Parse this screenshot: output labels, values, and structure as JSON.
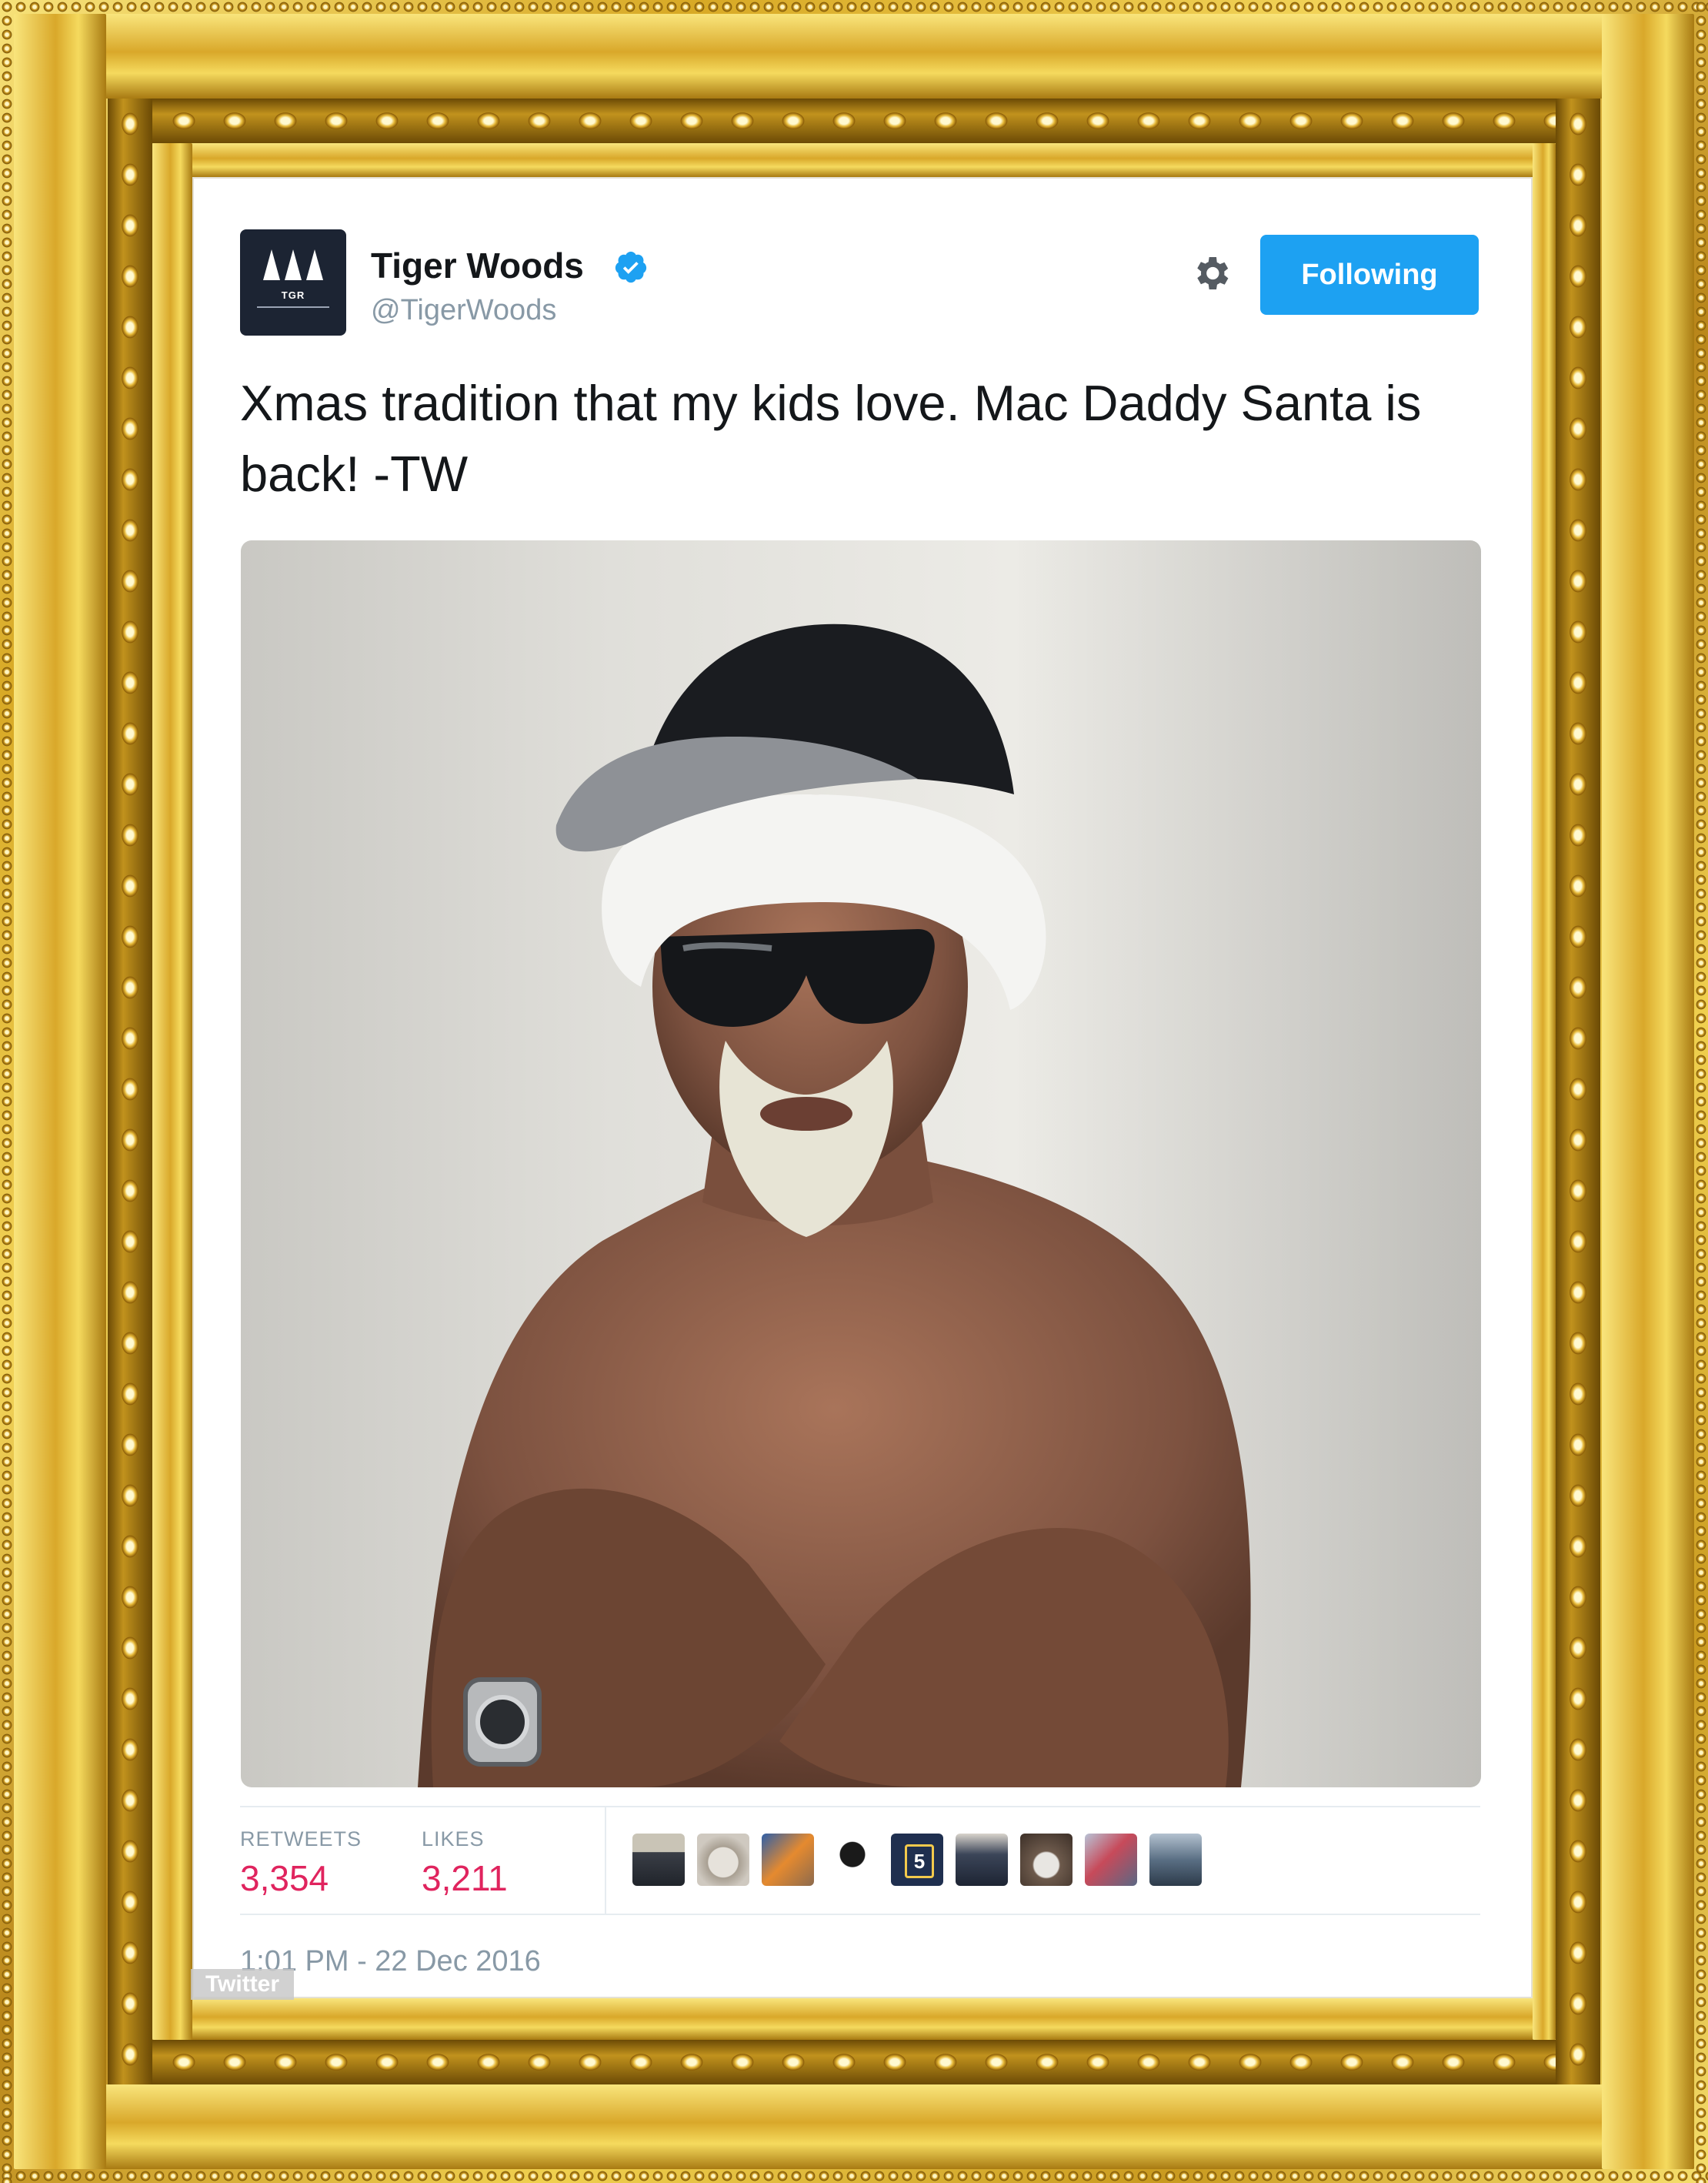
{
  "tweet": {
    "author_name": "Tiger Woods",
    "author_handle": "@TigerWoods",
    "avatar_text": "TGR",
    "follow_label": "Following",
    "text": "Xmas tradition that my kids love. Mac Daddy Santa is back! -TW",
    "retweets_label": "RETWEETS",
    "retweets_count": "3,354",
    "likes_label": "LIKES",
    "likes_count": "3,211",
    "timestamp": "1:01 PM - 22 Dec 2016",
    "watermark": "Twitter"
  },
  "icons": {
    "verified": "verified-badge-icon",
    "settings": "gear-icon"
  },
  "colors": {
    "follow_button": "#1da1f2",
    "stat_count": "#e0245e",
    "muted_text": "#8899a6",
    "frame_gold": "#d8a925"
  }
}
